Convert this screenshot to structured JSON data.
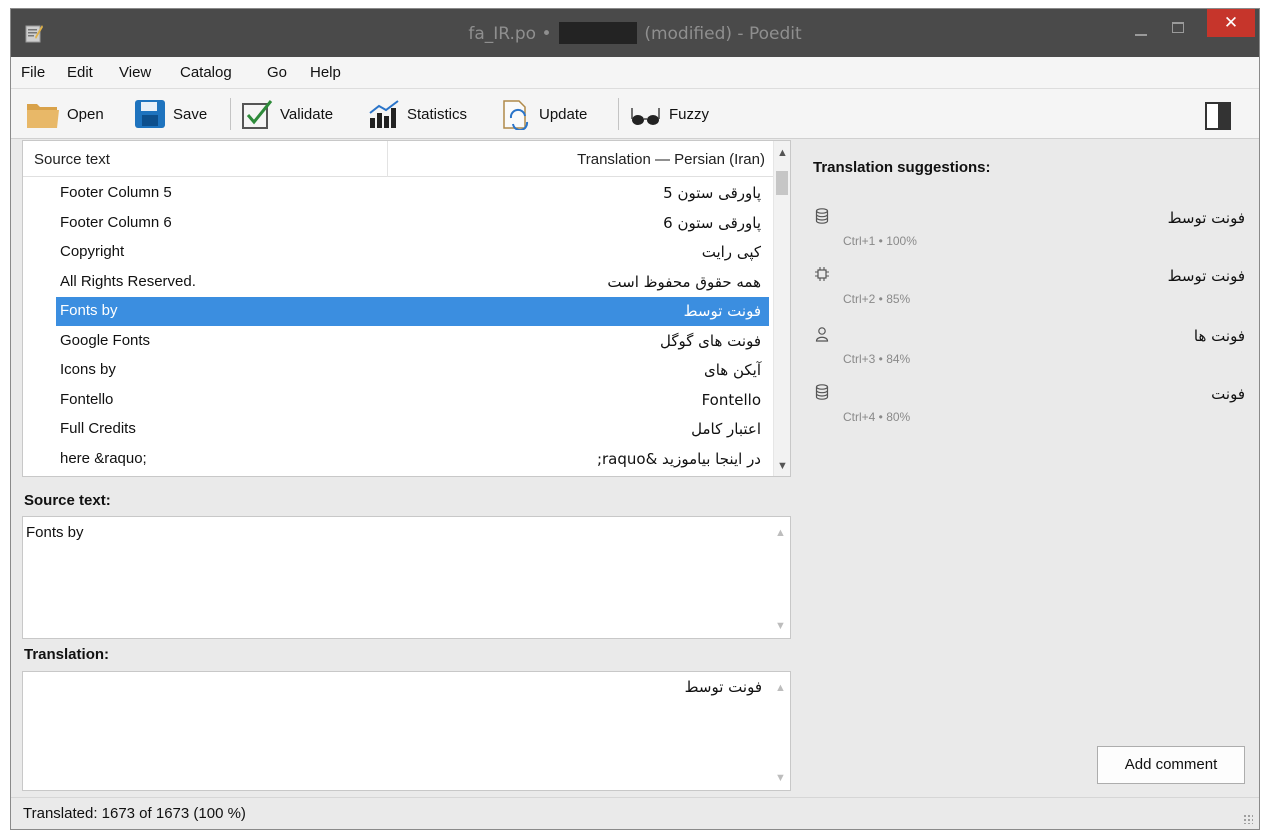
{
  "window": {
    "title_file": "fa_IR.po •",
    "title_suffix": "(modified) - Poedit",
    "close_glyph": "✕"
  },
  "menu": [
    "File",
    "Edit",
    "View",
    "Catalog",
    "Go",
    "Help"
  ],
  "toolbar": {
    "open": "Open",
    "save": "Save",
    "validate": "Validate",
    "statistics": "Statistics",
    "update": "Update",
    "fuzzy": "Fuzzy"
  },
  "list": {
    "col_source": "Source text",
    "col_translation": "Translation — Persian (Iran)",
    "rows": [
      {
        "src": "Footer Column 5",
        "trn": "پاورقی ستون 5"
      },
      {
        "src": "Footer Column 6",
        "trn": "پاورقی ستون 6"
      },
      {
        "src": "Copyright",
        "trn": "کپی رایت"
      },
      {
        "src": "All Rights Reserved.",
        "trn": "همه حقوق محفوظ است"
      },
      {
        "src": "Fonts by",
        "trn": "فونت توسط"
      },
      {
        "src": "Google Fonts",
        "trn": "فونت های گوگل"
      },
      {
        "src": "Icons by",
        "trn": "آیکن های"
      },
      {
        "src": "Fontello",
        "trn": "Fontello"
      },
      {
        "src": "Full Credits",
        "trn": "اعتبار کامل"
      },
      {
        "src": "here &raquo;",
        "trn": "در اینجا بیاموزید &raquo;"
      }
    ],
    "selected_index": 4
  },
  "source_pane": {
    "label": "Source text:",
    "text": "Fonts by"
  },
  "translation_pane": {
    "label": "Translation:",
    "text": "فونت توسط"
  },
  "suggestions": {
    "title": "Translation suggestions:",
    "items": [
      {
        "icon": "database-icon",
        "text": "فونت توسط",
        "meta": "Ctrl+1 • 100%"
      },
      {
        "icon": "chip-icon",
        "text": "فونت توسط",
        "meta": "Ctrl+2 • 85%"
      },
      {
        "icon": "person-icon",
        "text": "فونت ها",
        "meta": "Ctrl+3 • 84%"
      },
      {
        "icon": "database-icon",
        "text": "فونت",
        "meta": "Ctrl+4 • 80%"
      }
    ],
    "add_comment": "Add comment"
  },
  "status": {
    "text": "Translated: 1673 of 1673 (100 %)"
  },
  "colors": {
    "selection": "#3b8ee0",
    "titlebar": "#4a4a4a",
    "close_button": "#c6352b"
  }
}
